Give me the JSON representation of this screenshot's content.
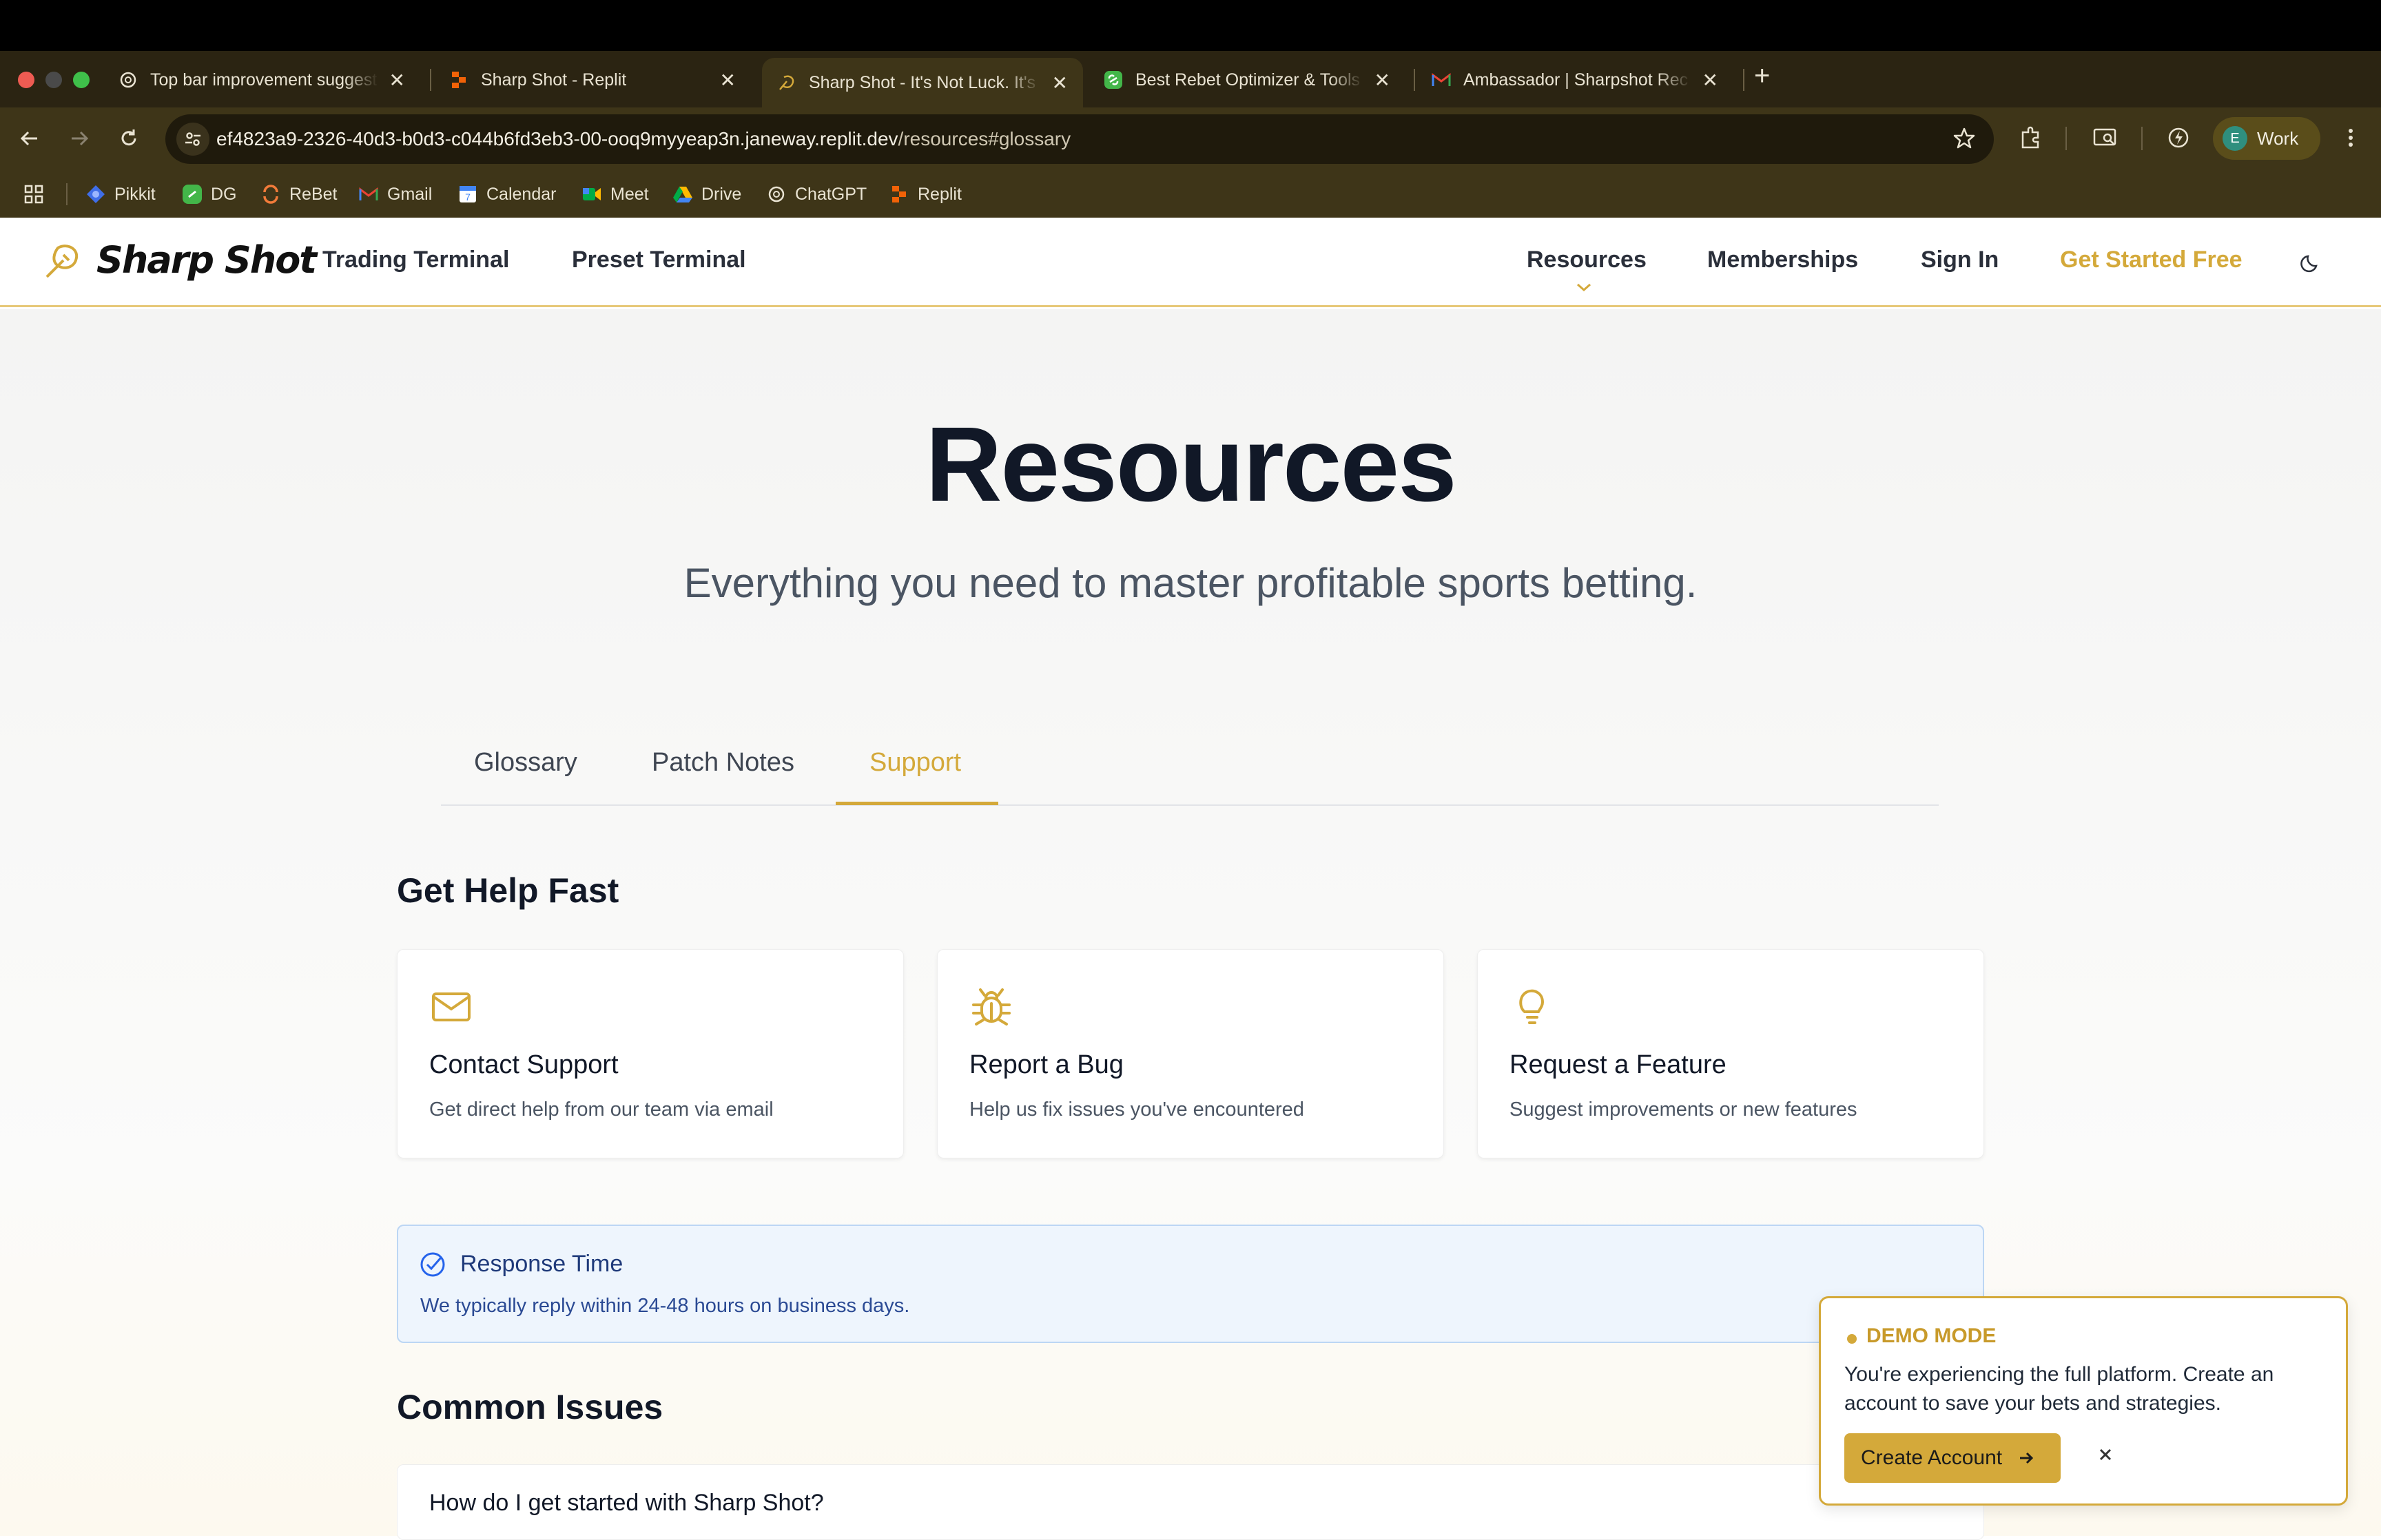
{
  "browser": {
    "tabs": [
      {
        "title": "Top bar improvement suggesti",
        "active": false
      },
      {
        "title": "Sharp Shot - Replit",
        "active": false
      },
      {
        "title": "Sharp Shot - It's Not Luck. It's",
        "active": true
      },
      {
        "title": "Best Rebet Optimizer & Tools",
        "active": false
      },
      {
        "title": "Ambassador | Sharpshot Rec",
        "active": false
      }
    ],
    "url_host": "ef4823a9-2326-40d3-b0d3-c044b6fd3eb3-00-ooq9myyeap3n.janeway.replit.dev",
    "url_path": "/resources#glossary",
    "profile_initial": "E",
    "profile_label": "Work",
    "bookmarks": [
      "Pikkit",
      "DG",
      "ReBet",
      "Gmail",
      "Calendar",
      "Meet",
      "Drive",
      "ChatGPT",
      "Replit"
    ]
  },
  "header": {
    "logo": "Sharp Shot",
    "nav_left": [
      "Trading Terminal",
      "Preset Terminal"
    ],
    "nav_right": [
      "Resources",
      "Memberships",
      "Sign In",
      "Get Started Free"
    ]
  },
  "hero": {
    "title": "Resources",
    "subtitle": "Everything you need to master profitable sports betting."
  },
  "page_tabs": [
    "Glossary",
    "Patch Notes",
    "Support"
  ],
  "active_tab": "Support",
  "help": {
    "title": "Get Help Fast",
    "cards": [
      {
        "title": "Contact Support",
        "desc": "Get direct help from our team via email",
        "icon": "mail-icon"
      },
      {
        "title": "Report a Bug",
        "desc": "Help us fix issues you've encountered",
        "icon": "bug-icon"
      },
      {
        "title": "Request a Feature",
        "desc": "Suggest improvements or new features",
        "icon": "lightbulb-icon"
      }
    ]
  },
  "response_time": {
    "title": "Response Time",
    "text": "We typically reply within 24-48 hours on business days."
  },
  "common_issues": {
    "title": "Common Issues",
    "items": [
      "How do I get started with Sharp Shot?"
    ]
  },
  "demo": {
    "label": "DEMO MODE",
    "text": "You're experiencing the full platform. Create an account to save your bets and strategies.",
    "button": "Create Account"
  },
  "colors": {
    "brand_gold": "#d4a93a",
    "chrome_dark": "#3e3518",
    "text_dark": "#111827",
    "notice_blue": "#eef5fd"
  }
}
